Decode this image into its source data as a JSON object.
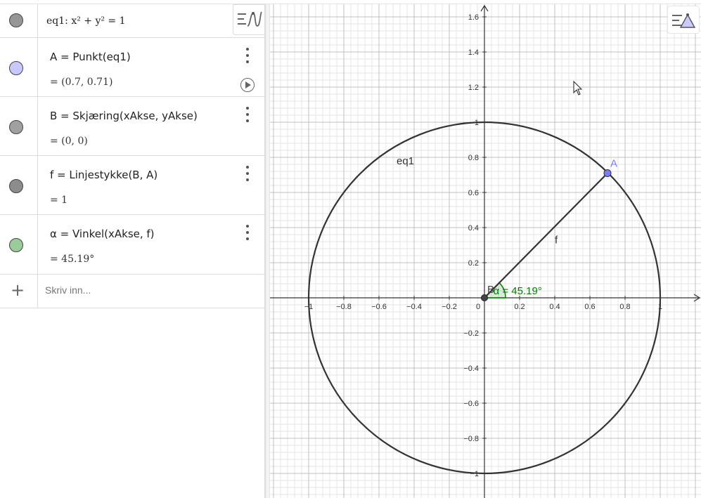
{
  "algebra": {
    "rows": [
      {
        "id": "eq1",
        "color": "#969696",
        "definition": "eq1: x² + y² = 1",
        "value": ""
      },
      {
        "id": "A",
        "color": "#c8c8ff",
        "definition": "A = Punkt(eq1)",
        "value": "= (0.7, 0.71)"
      },
      {
        "id": "B",
        "color": "#a0a0a0",
        "definition": "B = Skjæring(xAkse, yAkse)",
        "value": "= (0, 0)"
      },
      {
        "id": "f",
        "color": "#8c8c8c",
        "definition": "f = Linjestykke(B, A)",
        "value": "= 1"
      },
      {
        "id": "alpha",
        "color": "#99cc99",
        "definition": "α = Vinkel(xAkse, f)",
        "value": "= 45.19°"
      }
    ],
    "input_placeholder": "Skriv inn..."
  },
  "icons": {
    "style_toggle": "algebra-style-icon",
    "graphics_style": "graphics-style-icon",
    "menu": "more-vert-icon",
    "play": "play-icon",
    "add": "plus-icon"
  },
  "colors": {
    "circle": "#333333",
    "point_A": "#7b7bff",
    "point_B": "#444444",
    "angle": "#007f00",
    "grid_major": "#c0c0c0",
    "grid_minor": "#e6e6e6"
  },
  "graph": {
    "xmin": -1.22,
    "xmax": 1.22,
    "ymin": -1.13,
    "ymax": 1.68,
    "x_ticks": [
      "−1",
      "−0.8",
      "−0.6",
      "−0.4",
      "−0.2",
      "0",
      "0.2",
      "0.4",
      "0.6",
      "0.8",
      "1"
    ],
    "y_ticks": [
      "−1",
      "−0.8",
      "−0.6",
      "−0.4",
      "−0.2",
      "0.2",
      "0.4",
      "0.6",
      "0.8",
      "1",
      "1.2",
      "1.4",
      "1.6"
    ],
    "labels": {
      "circle": "eq1",
      "point_A": "A",
      "point_B": "B",
      "segment": "f",
      "angle": "α = 45.19°"
    },
    "point_A": {
      "x": 0.7,
      "y": 0.71
    },
    "point_B": {
      "x": 0,
      "y": 0
    },
    "circle": {
      "cx": 0,
      "cy": 0,
      "r": 1
    },
    "angle_deg": 45.19
  }
}
